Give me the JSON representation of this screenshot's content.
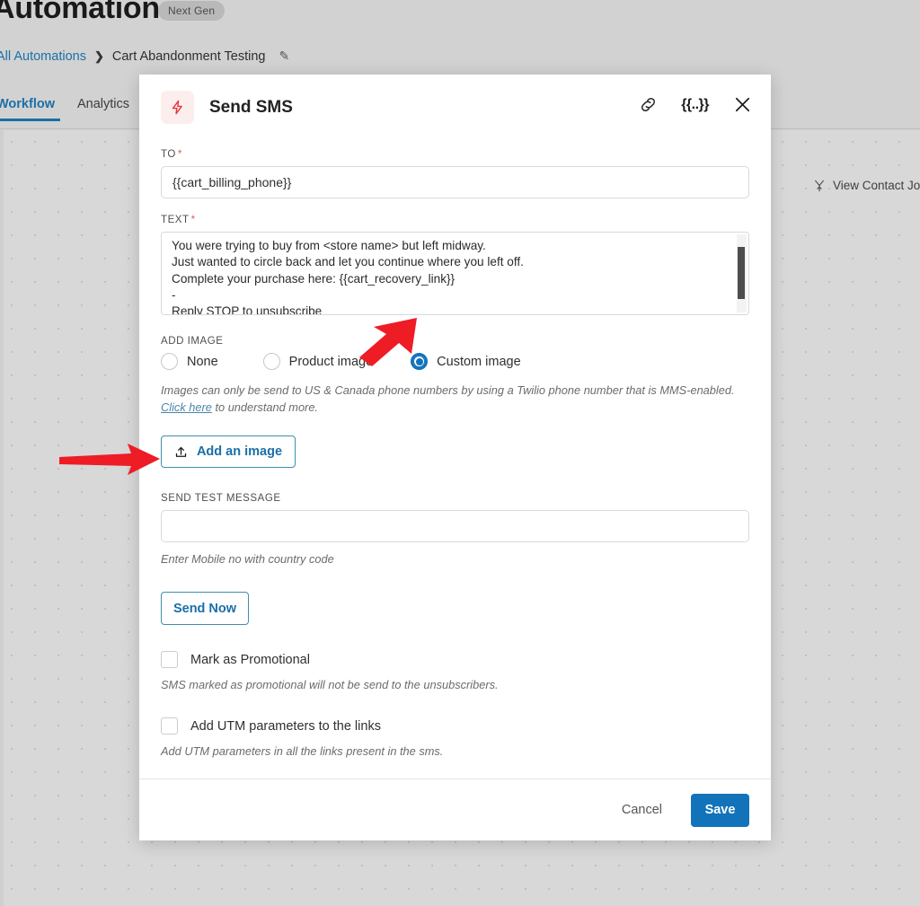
{
  "page": {
    "title": "Automations",
    "badge": "Next Gen",
    "breadcrumb": {
      "root": "All Automations",
      "separator": "❯",
      "current": "Cart Abandonment Testing",
      "edit_icon": "✎"
    },
    "tabs": [
      {
        "label": "Workflow",
        "active": true
      },
      {
        "label": "Analytics",
        "active": false
      }
    ],
    "canvas_action": "View Contact Jou"
  },
  "modal": {
    "title": "Send SMS",
    "icons": {
      "bolt": "bolt-icon",
      "link": "link-icon",
      "merge_tag": "{{..}}",
      "close": "close-icon"
    },
    "to": {
      "label": "TO",
      "required": "*",
      "value": "{{cart_billing_phone}}",
      "placeholder": ""
    },
    "text": {
      "label": "TEXT",
      "required": "*",
      "value": "You were trying to buy from <store name> but left midway.\nJust wanted to circle back and let you continue where you left off.\nComplete your purchase here: {{cart_recovery_link}}\n-\nReply STOP to unsubscribe"
    },
    "add_image": {
      "label": "ADD IMAGE",
      "options": [
        {
          "label": "None",
          "selected": false
        },
        {
          "label": "Product image",
          "selected": false
        },
        {
          "label": "Custom image",
          "selected": true
        }
      ],
      "note_line1": "Images can only be send to US & Canada phone numbers by using a Twilio phone number that is MMS-enabled.",
      "note_link": "Click here",
      "note_line2_rest": " to understand more.",
      "button_label": "Add an image",
      "button_icon": "upload-icon"
    },
    "send_test": {
      "label": "SEND TEST MESSAGE",
      "value": "",
      "placeholder": "",
      "hint": "Enter Mobile no with country code",
      "send_now_label": "Send Now"
    },
    "promotional": {
      "label": "Mark as Promotional",
      "checked": false,
      "hint": "SMS marked as promotional will not be send to the unsubscribers."
    },
    "utm": {
      "label": "Add UTM parameters to the links",
      "checked": false,
      "hint": "Add UTM parameters in all the links present in the sms."
    },
    "footer": {
      "cancel_label": "Cancel",
      "save_label": "Save"
    }
  },
  "colors": {
    "accent_blue": "#1273ba",
    "link_blue": "#1b6fa8",
    "teal_border": "#3d8fab",
    "bolt_red": "#e0393e",
    "annotation_red": "#ee1c25",
    "required_red": "#e05b5b"
  }
}
